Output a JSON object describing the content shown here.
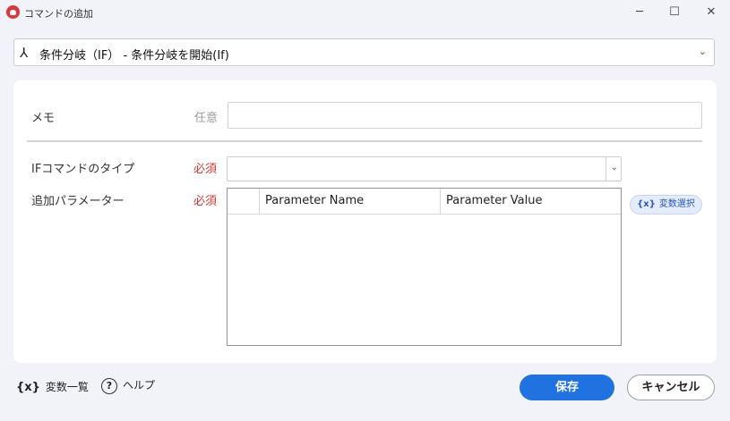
{
  "window": {
    "title": "コマンドの追加",
    "minimize_glyph": "─",
    "maximize_glyph": "☐",
    "close_glyph": "✕"
  },
  "command": {
    "icon": "branch-icon",
    "icon_glyph": "⅄",
    "label": "条件分岐（IF） - 条件分岐を開始(If)",
    "chevron": "⌄"
  },
  "form": {
    "memo": {
      "label": "メモ",
      "qualifier": "任意",
      "value": ""
    },
    "if_type": {
      "label": "IFコマンドのタイプ",
      "qualifier": "必須",
      "value": "",
      "chevron": "⌄"
    },
    "params": {
      "label": "追加パラメーター",
      "qualifier": "必須",
      "columns": [
        "",
        "Parameter Name",
        "Parameter Value"
      ],
      "rows": []
    },
    "var_select": {
      "icon_text": "{x}",
      "label": "変数選択"
    }
  },
  "footer": {
    "var_list": {
      "icon_text": "{x}",
      "label": "変数一覧"
    },
    "help": {
      "icon_text": "?",
      "label": "ヘルプ"
    },
    "save_label": "保存",
    "cancel_label": "キャンセル"
  },
  "colors": {
    "accent": "#1f72e0",
    "required": "#d13a36",
    "background": "#f1f3f8"
  }
}
